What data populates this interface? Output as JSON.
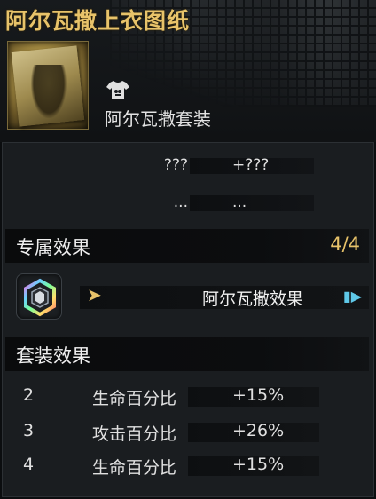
{
  "item": {
    "title": "阿尔瓦撒上衣图纸",
    "set_name": "阿尔瓦撒套装",
    "icon": "blueprint-image",
    "type_icon": "shirt-icon"
  },
  "stats": [
    {
      "name": "???",
      "value": "+???"
    },
    {
      "name": "...",
      "value": "..."
    }
  ],
  "exclusive": {
    "label": "专属效果",
    "count": "4/4",
    "effect_name": "阿尔瓦撒效果",
    "gem_icon": "hexagon-gem-icon",
    "arrow": "➤",
    "play_icon": "play-icon",
    "play_glyph": "▮▶"
  },
  "set_effects": {
    "label": "套装效果",
    "rows": [
      {
        "num": "2",
        "attr": "生命百分比",
        "value": "+15%"
      },
      {
        "num": "3",
        "attr": "攻击百分比",
        "value": "+26%"
      },
      {
        "num": "4",
        "attr": "生命百分比",
        "value": "+15%"
      }
    ]
  },
  "colors": {
    "accent_gold": "#e8c36a",
    "accent_cyan": "#5fc8e8",
    "panel_bg": "#1a1d20"
  }
}
